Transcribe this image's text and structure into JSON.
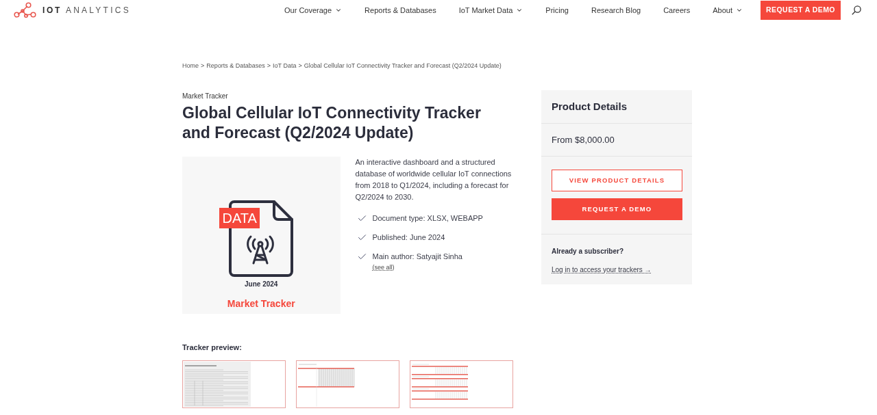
{
  "header": {
    "logo": {
      "strong": "IOT",
      "light": "ANALYTICS"
    },
    "nav": [
      {
        "label": "Our Coverage",
        "has_menu": true
      },
      {
        "label": "Reports & Databases",
        "has_menu": false
      },
      {
        "label": "IoT Market Data",
        "has_menu": true
      },
      {
        "label": "Pricing",
        "has_menu": false
      },
      {
        "label": "Research Blog",
        "has_menu": false
      },
      {
        "label": "Careers",
        "has_menu": false
      },
      {
        "label": "About",
        "has_menu": true
      }
    ],
    "cta": "REQUEST A DEMO"
  },
  "breadcrumb": {
    "separator": ">",
    "items": [
      "Home",
      "Reports & Databases",
      "IoT Data",
      "Global Cellular IoT Connectivity Tracker and Forecast (Q2/2024 Update)"
    ]
  },
  "product": {
    "category": "Market Tracker",
    "title": "Global Cellular IoT Connectivity Tracker and Forecast (Q2/2024 Update)",
    "image": {
      "badge": "DATA",
      "date": "June 2024",
      "caption": "Market Tracker"
    },
    "description": "An interactive dashboard and a structured database of worldwide cellular IoT connections from 2018 to Q1/2024, including a forecast for Q2/2024 to 2030.",
    "facts": [
      {
        "text": "Document type: XLSX, WEBAPP"
      },
      {
        "text": "Published: June 2024"
      },
      {
        "text": "Main author: Satyajit Sinha",
        "link": "(see all)"
      }
    ]
  },
  "details": {
    "title": "Product Details",
    "price": "From $8,000.00",
    "buttons": [
      {
        "label": "VIEW PRODUCT DETAILS",
        "kind": "outline"
      },
      {
        "label": "REQUEST A DEMO",
        "kind": "filled"
      }
    ],
    "subscriber_prompt": "Already a subscriber?",
    "login_link": "Log in to access your trackers →"
  },
  "preview": {
    "title": "Tracker preview:",
    "thumbnails": [
      {
        "kind": "document"
      },
      {
        "kind": "table"
      },
      {
        "kind": "tables"
      }
    ]
  }
}
